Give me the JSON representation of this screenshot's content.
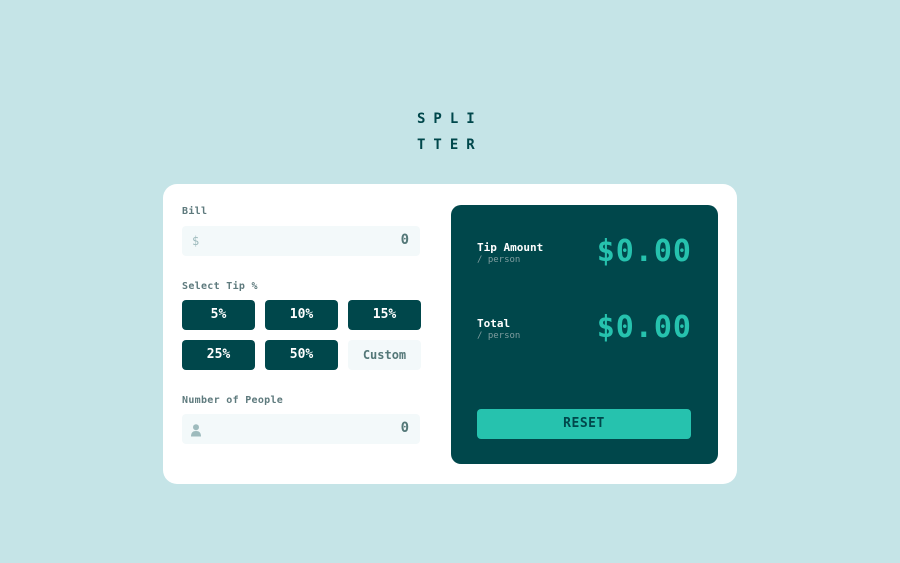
{
  "logo": {
    "line1": "SPLI",
    "line2": "TTER"
  },
  "bill": {
    "label": "Bill",
    "prefix": "$",
    "value": "0"
  },
  "tip": {
    "label": "Select Tip %",
    "options": [
      "5%",
      "10%",
      "15%",
      "25%",
      "50%"
    ],
    "custom_label": "Custom"
  },
  "people": {
    "label": "Number of People",
    "value": "0"
  },
  "results": {
    "tip_title": "Tip Amount",
    "tip_sub": "/ person",
    "tip_value": "$0.00",
    "total_title": "Total",
    "total_sub": "/ person",
    "total_value": "$0.00",
    "reset_label": "RESET"
  },
  "colors": {
    "background": "#c5e4e7",
    "dark_cyan": "#00474b",
    "accent": "#26c2ae",
    "input_bg": "#f3f9fa"
  }
}
